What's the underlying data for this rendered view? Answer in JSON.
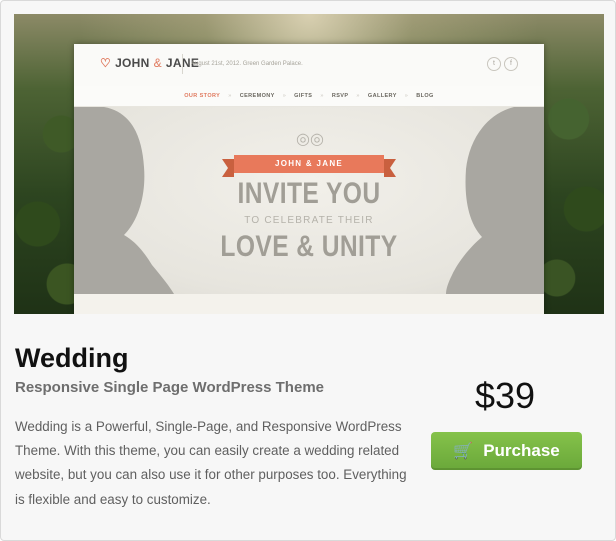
{
  "preview": {
    "site_logo": {
      "name": "JOHN",
      "amp": "&",
      "name2": "JANE"
    },
    "tagline": "August 21st, 2012. Green Garden Palace.",
    "social": [
      "t",
      "f"
    ],
    "nav": [
      "OUR STORY",
      "CEREMONY",
      "GIFTS",
      "RSVP",
      "GALLERY",
      "BLOG"
    ],
    "nav_active": "OUR STORY",
    "ribbon": "JOHN & JANE",
    "line1": "INVITE YOU",
    "line2": "TO CELEBRATE THEIR",
    "line3": "LOVE & UNITY"
  },
  "product": {
    "title": "Wedding",
    "subtitle": "Responsive Single Page WordPress Theme",
    "description": "Wedding is a Powerful, Single-Page, and Responsive WordPress Theme. With this theme, you can easily create a wedding related website, but you can also use it for other purposes too. Everything is flexible and easy to customize.",
    "price": "$39",
    "purchase_label": "Purchase"
  },
  "colors": {
    "accent": "#e07a5f",
    "button": "#74b442"
  },
  "icons": {
    "cart": "shopping-cart-icon",
    "heart": "heart-icon",
    "rings": "rings-icon"
  }
}
